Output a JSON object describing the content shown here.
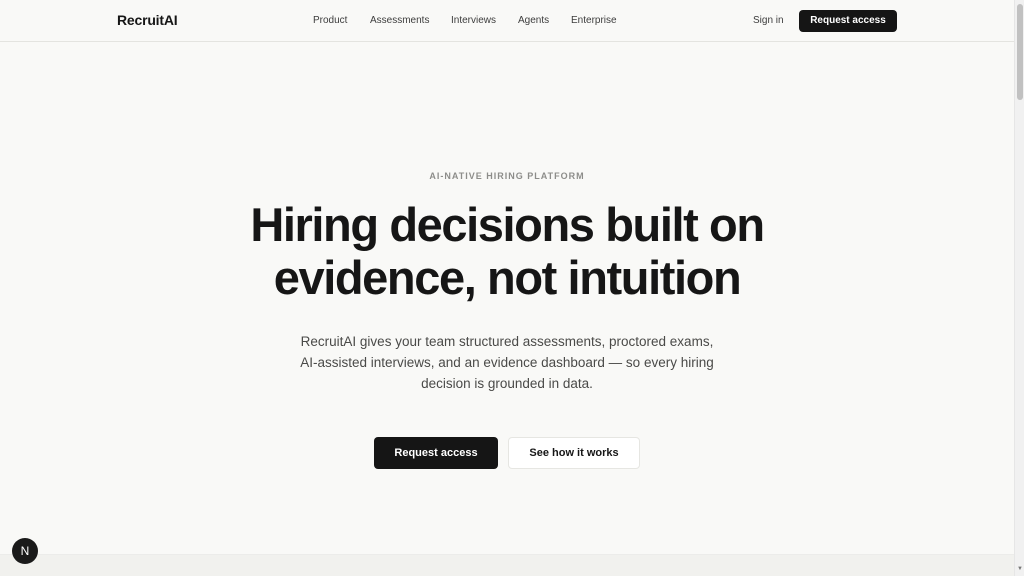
{
  "header": {
    "brand": "RecruitAI",
    "nav": [
      {
        "label": "Product"
      },
      {
        "label": "Assessments"
      },
      {
        "label": "Interviews"
      },
      {
        "label": "Agents"
      },
      {
        "label": "Enterprise"
      }
    ],
    "signin_label": "Sign in",
    "cta_label": "Request access"
  },
  "hero": {
    "eyebrow": "AI-NATIVE HIRING PLATFORM",
    "headline_line1": "Hiring decisions built on",
    "headline_line2": "evidence, not intuition",
    "subtext": "RecruitAI gives your team structured assessments, proctored exams, AI-assisted interviews, and an evidence dashboard — so every hiring decision is grounded in data.",
    "primary_cta": "Request access",
    "secondary_cta": "See how it works"
  },
  "badge": {
    "letter": "N"
  },
  "colors": {
    "background": "#f9f9f7",
    "primary_button": "#151515",
    "text": "#161616",
    "muted": "#8d8d8a"
  },
  "icons": {
    "badge_icon": "n-logo-icon"
  }
}
